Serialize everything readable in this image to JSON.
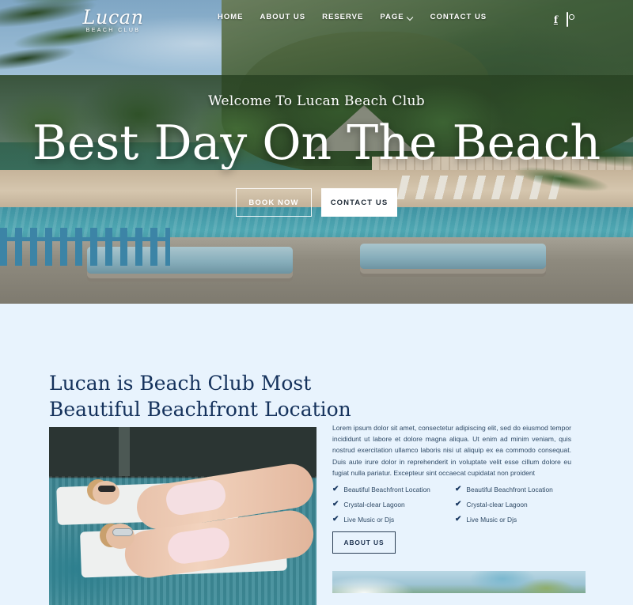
{
  "brand": {
    "name": "Lucan",
    "tagline": "BEACH CLUB"
  },
  "nav": {
    "items": [
      {
        "label": "HOME"
      },
      {
        "label": "ABOUT US"
      },
      {
        "label": "RESERVE"
      },
      {
        "label": "PAGE"
      },
      {
        "label": "CONTACT US"
      }
    ],
    "socials": [
      {
        "name": "facebook-icon",
        "glyph": "f"
      },
      {
        "name": "instagram-icon",
        "glyph": ""
      }
    ]
  },
  "hero": {
    "eyebrow": "Welcome To Lucan Beach Club",
    "title": "Best Day On The Beach",
    "primary_button": "BOOK NOW",
    "secondary_button": "CONTACT US"
  },
  "about": {
    "heading_line1": "Lucan is Beach Club Most",
    "heading_line2": "Beautiful Beachfront Location",
    "paragraph": "Lorem ipsum dolor sit amet, consectetur adipiscing elit, sed do eiusmod tempor incididunt ut labore et dolore magna aliqua. Ut enim ad minim veniam, quis nostrud exercitation ullamco laboris nisi ut aliquip ex ea commodo consequat. Duis aute irure dolor in reprehenderit in voluptate velit esse cillum dolore eu fugiat nulla pariatur. Excepteur sint occaecat cupidatat non proident",
    "features_left": [
      "Beautiful Beachfront Location",
      "Crystal-clear Lagoon",
      "Live Music or Djs"
    ],
    "features_right": [
      "Beautiful Beachfront Location",
      "Crystal-clear Lagoon",
      "Live Music or Djs"
    ],
    "check_glyph": "✔",
    "button": "ABOUT US"
  },
  "colors": {
    "section_background": "#e8f3fd",
    "heading": "#15325c",
    "body_text": "#2f4a66",
    "button_border": "#2c3f55"
  }
}
